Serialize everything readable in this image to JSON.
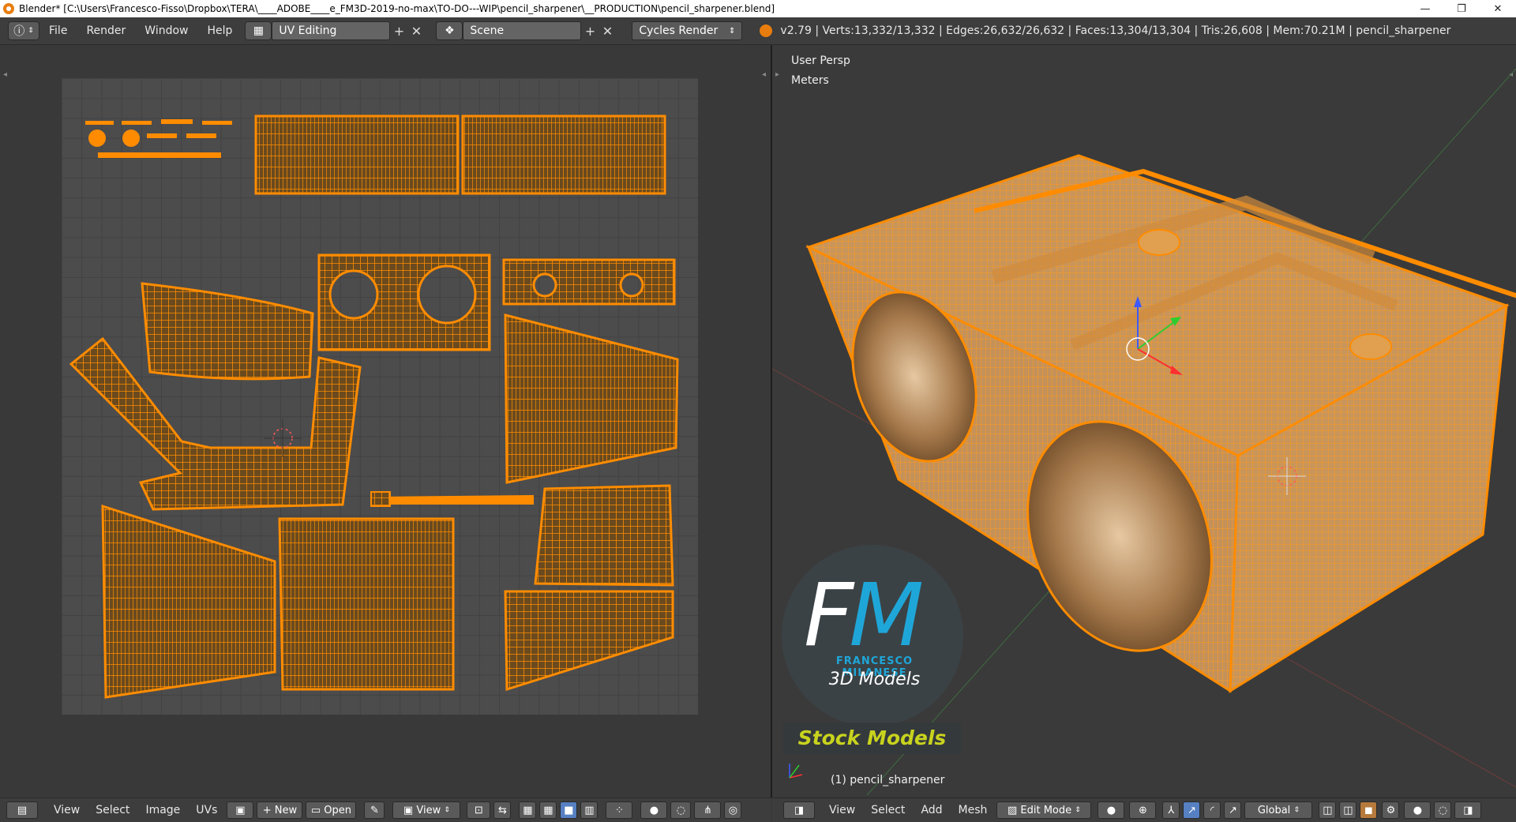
{
  "window": {
    "title": "Blender* [C:\\Users\\Francesco-Fisso\\Dropbox\\TERA\\____ADOBE____e_FM3D-2019-no-max\\TO-DO---WIP\\pencil_sharpener\\__PRODUCTION\\pencil_sharpener.blend]",
    "controls": [
      "—",
      "❐",
      "✕"
    ]
  },
  "info_header": {
    "menus": [
      "File",
      "Render",
      "Window",
      "Help"
    ],
    "screen_layout": "UV Editing",
    "scene": "Scene",
    "render_engine": "Cycles Render",
    "stats": "v2.79 | Verts:13,332/13,332 | Edges:26,632/26,632 | Faces:13,304/13,304 | Tris:26,608 | Mem:70.21M | pencil_sharpener"
  },
  "uv_header": {
    "menus": [
      "View",
      "Select",
      "Image",
      "UVs"
    ],
    "new_label": "New",
    "open_label": "Open",
    "view_label": "View"
  },
  "viewport": {
    "view_name": "User Persp",
    "units": "Meters",
    "object_label": "(1) pencil_sharpener"
  },
  "view3d_header": {
    "menus": [
      "View",
      "Select",
      "Add",
      "Mesh"
    ],
    "mode": "Edit Mode",
    "orientation": "Global"
  },
  "branding": {
    "logo_f": "F",
    "logo_m": "M",
    "name": "FRANCESCO MILANESE",
    "subtitle": "3D Models",
    "tagline": "Stock Models"
  },
  "colors": {
    "mesh_orange": "#ff8c00",
    "background": "#393939",
    "accent_blue": "#1fa6d8",
    "tagline_yellow": "#c8d31e"
  }
}
